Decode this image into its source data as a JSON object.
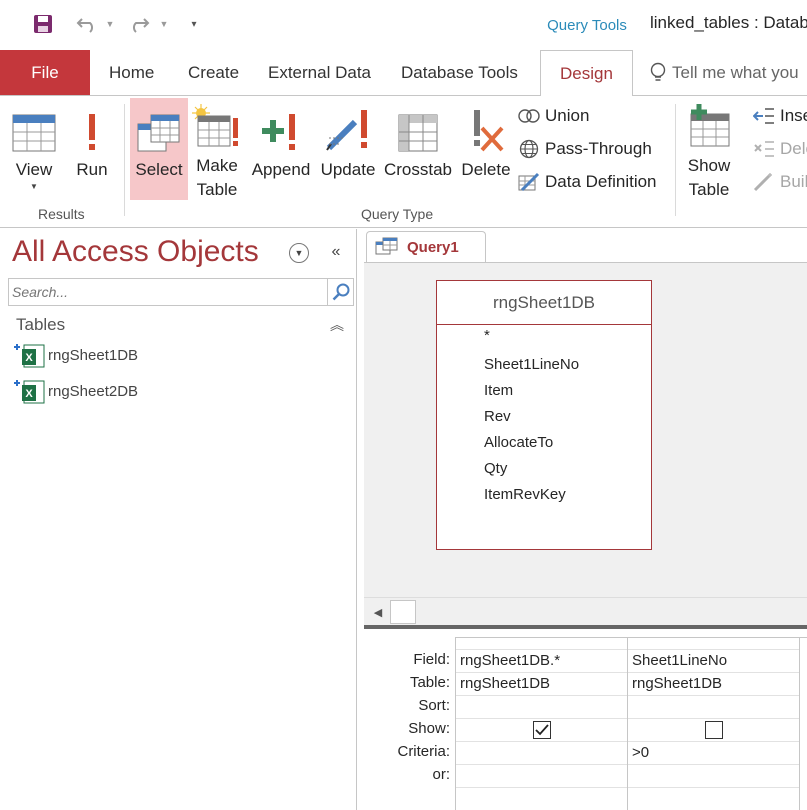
{
  "title_bar": {
    "contextual_group": "Query Tools",
    "window_title": "linked_tables : Datab"
  },
  "ribbon_tabs": {
    "file": "File",
    "home": "Home",
    "create": "Create",
    "external_data": "External Data",
    "database_tools": "Database Tools",
    "design": "Design",
    "tell_me": "Tell me what you"
  },
  "ribbon": {
    "results": {
      "label": "Results",
      "view": "View",
      "run": "Run"
    },
    "query_type": {
      "label": "Query Type",
      "select_l1": "Select",
      "make_table_l1": "Make",
      "make_table_l2": "Table",
      "append": "Append",
      "update": "Update",
      "crosstab": "Crosstab",
      "delete": "Delete",
      "union": "Union",
      "pass_through": "Pass-Through",
      "data_definition": "Data Definition"
    },
    "query_setup": {
      "show_table_l1": "Show",
      "show_table_l2": "Table",
      "insert": "Inse",
      "delete": "Dele",
      "builder": "Buil"
    }
  },
  "nav_pane": {
    "title": "All Access Objects",
    "search_placeholder": "Search...",
    "section": "Tables",
    "items": [
      "rngSheet1DB",
      "rngSheet2DB"
    ]
  },
  "document": {
    "tab_label": "Query1",
    "table_box": {
      "name": "rngSheet1DB",
      "fields": [
        "*",
        "Sheet1LineNo",
        "Item",
        "Rev",
        "AllocateTo",
        "Qty",
        "ItemRevKey"
      ]
    }
  },
  "qbe_grid": {
    "row_labels": {
      "field": "Field:",
      "table": "Table:",
      "sort": "Sort:",
      "show": "Show:",
      "criteria": "Criteria:",
      "or": "or:"
    },
    "columns": [
      {
        "field": "rngSheet1DB.*",
        "table": "rngSheet1DB",
        "sort": "",
        "show": true,
        "criteria": "",
        "or": ""
      },
      {
        "field": "Sheet1LineNo",
        "table": "rngSheet1DB",
        "sort": "",
        "show": false,
        "criteria": ">0",
        "or": ""
      }
    ]
  },
  "colors": {
    "access_red": "#a4373a",
    "file_tab": "#c4373c",
    "selected_button": "#f6c7c9",
    "contextual_blue": "#2b8bb9"
  }
}
